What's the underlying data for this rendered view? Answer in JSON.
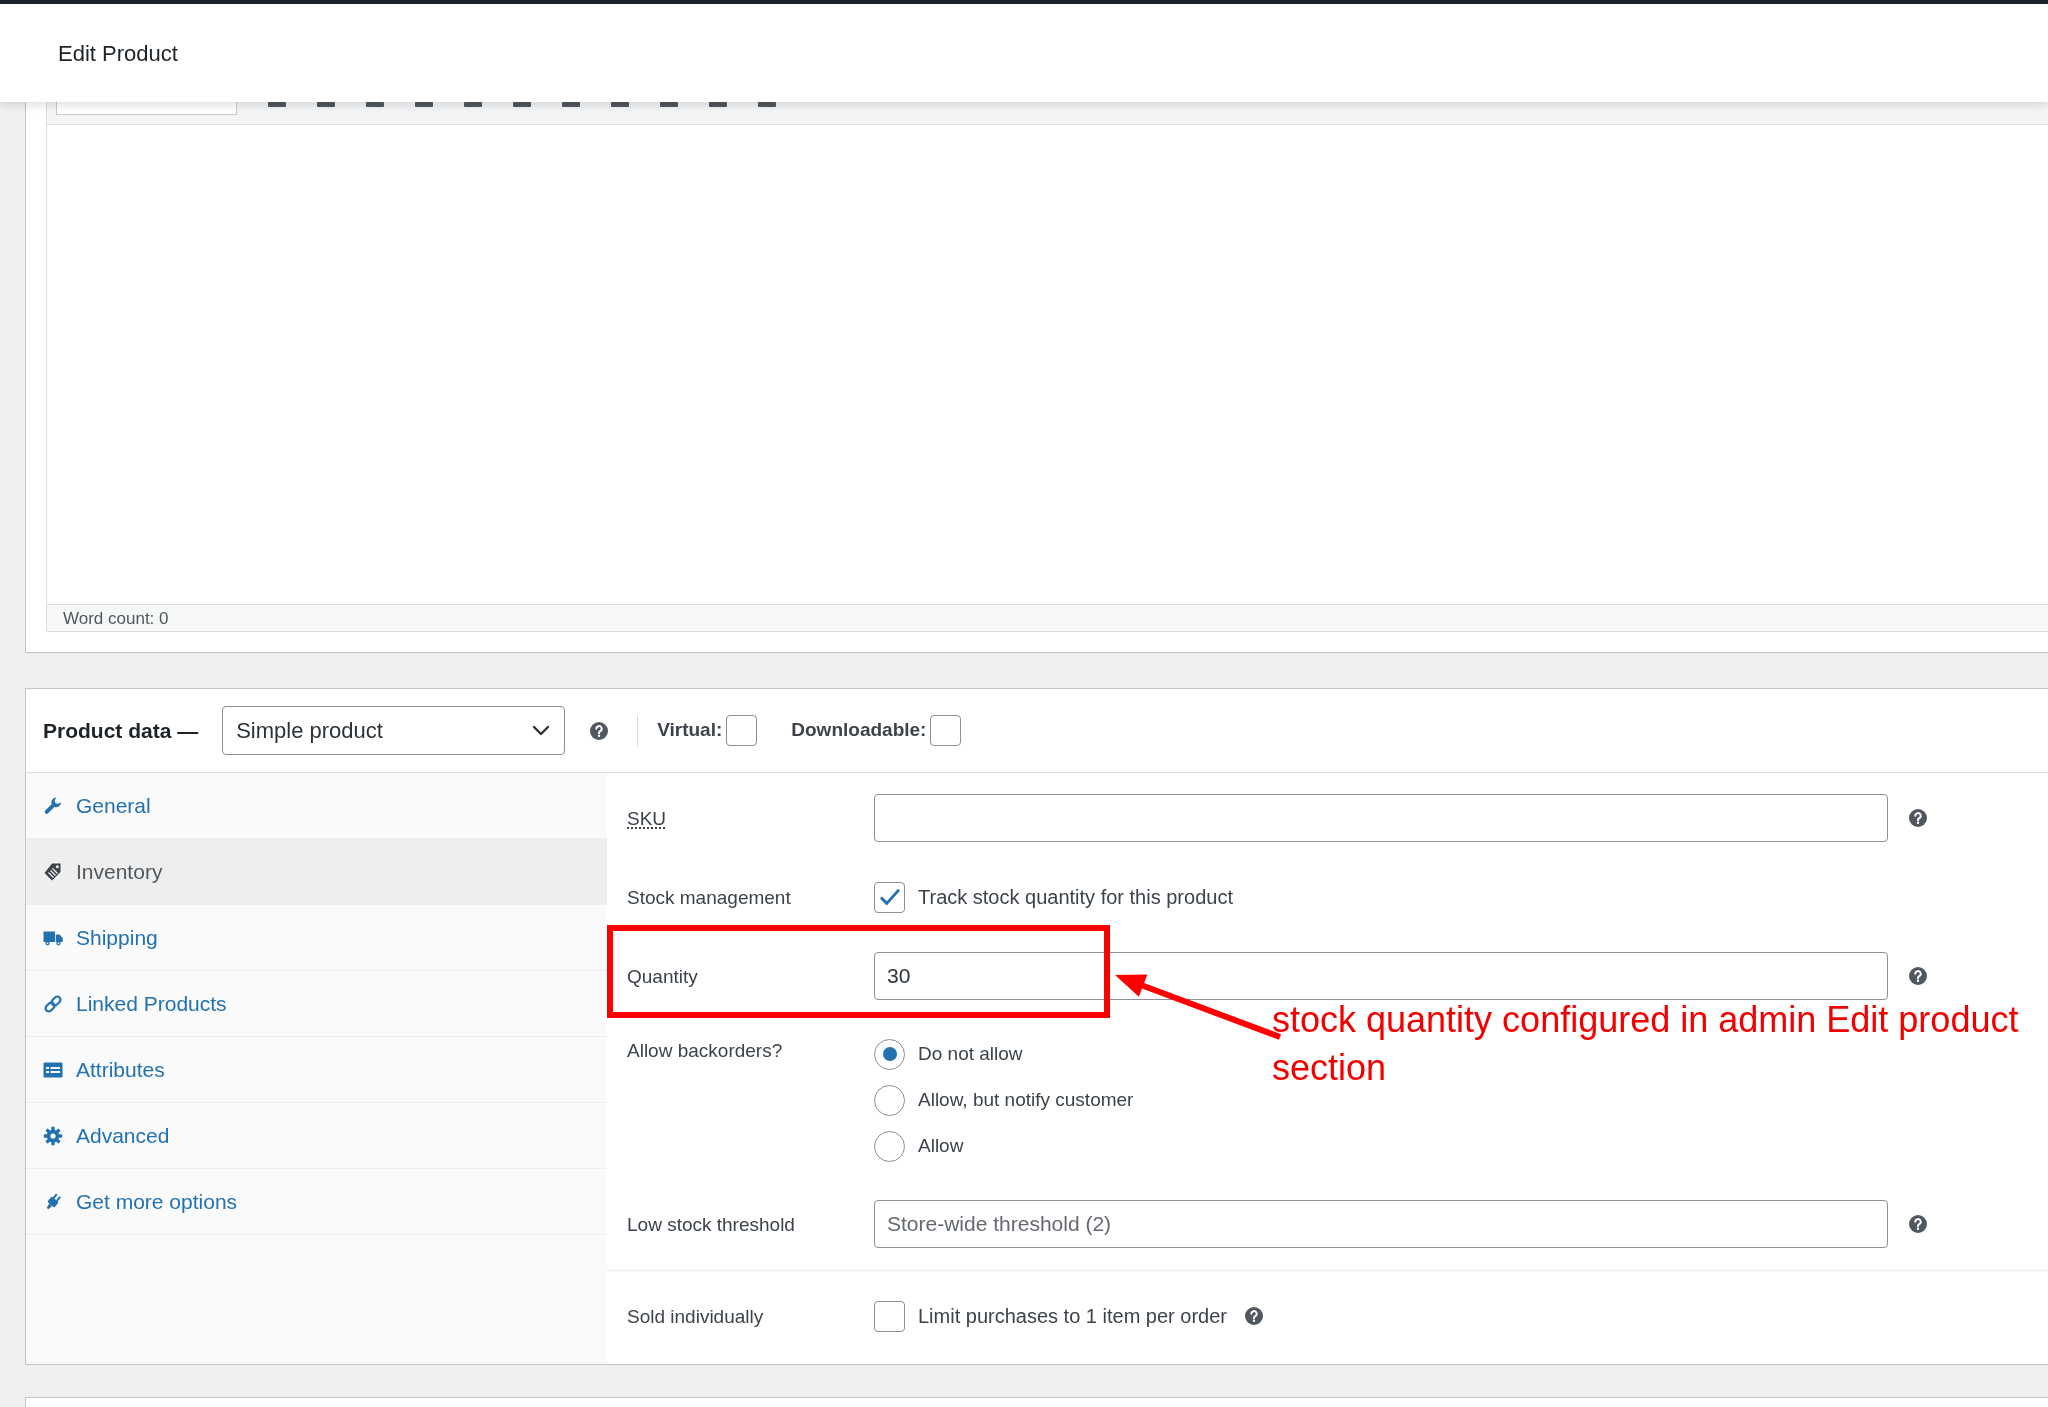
{
  "header": {
    "title": "Edit Product"
  },
  "editor": {
    "word_count": "Word count: 0"
  },
  "product_data": {
    "title": "Product data —",
    "product_type": {
      "value": "Simple product",
      "help": true
    },
    "options": [
      {
        "label": "Virtual:",
        "checked": false
      },
      {
        "label": "Downloadable:",
        "checked": false
      }
    ]
  },
  "tabs": [
    {
      "label": "General",
      "selected": false
    },
    {
      "label": "Inventory",
      "selected": true
    },
    {
      "label": "Shipping",
      "selected": false
    },
    {
      "label": "Linked Products",
      "selected": false
    },
    {
      "label": "Attributes",
      "selected": false
    },
    {
      "label": "Advanced",
      "selected": false
    },
    {
      "label": "Get more options",
      "selected": false
    }
  ],
  "field_groups": [
    [
      {
        "kind": "text",
        "label": "SKU",
        "abbreviation": true,
        "help": true
      },
      {
        "kind": "checkbox",
        "label": "Stock management",
        "abbreviation": false,
        "text": "Track stock quantity for this product",
        "checked": true,
        "help": false
      },
      {
        "kind": "text",
        "label": "Quantity",
        "abbreviation": false,
        "value": "30",
        "help": true
      },
      {
        "kind": "radio",
        "label": "Allow backorders?",
        "abbreviation": false,
        "options": [
          {
            "label": "Do not allow",
            "selected": true
          },
          {
            "label": "Allow, but notify customer",
            "selected": false
          },
          {
            "label": "Allow",
            "selected": false
          }
        ],
        "help": false
      },
      {
        "kind": "text",
        "label": "Low stock threshold",
        "abbreviation": false,
        "placeholder": "Store-wide threshold (2)",
        "help": true
      }
    ],
    [
      {
        "kind": "checkbox",
        "label": "Sold individually",
        "abbreviation": false,
        "text": "Limit purchases to 1 item per order",
        "checked": false,
        "help": true
      }
    ]
  ],
  "annotation": {
    "text": "stock quantity configured in admin Edit product section"
  }
}
